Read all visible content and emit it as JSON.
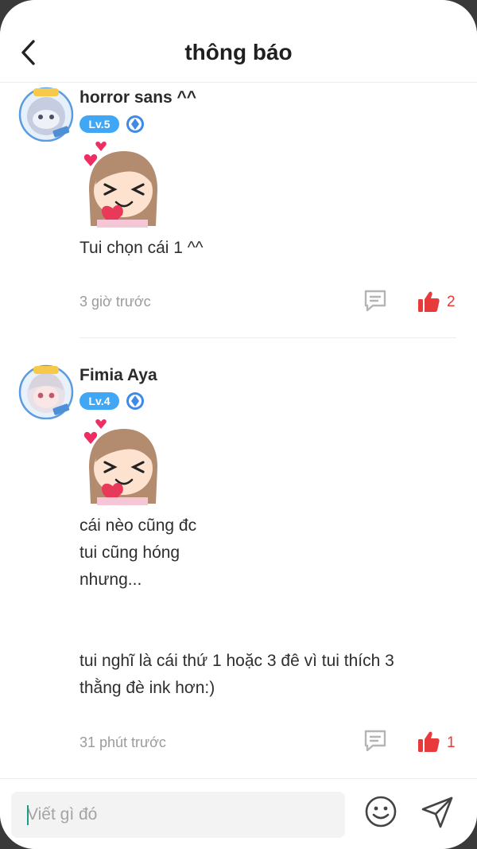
{
  "header": {
    "title": "thông báo",
    "back_icon": "chevron-left-icon"
  },
  "comments": [
    {
      "username": "horror sans ^^",
      "level": "Lv.5",
      "text_lines": [
        "Tui chọn cái 1 ^^"
      ],
      "time": "3 giờ trước",
      "likes": "2"
    },
    {
      "username": "Fimia Aya",
      "level": "Lv.4",
      "text_lines": [
        "cái nèo cũng đc",
        "tui cũng hóng",
        "nhưng...",
        "",
        "",
        "tui nghĩ là cái thứ 1 hoặc 3 đê vì tui thích 3",
        "thằng đè ink hơn:)"
      ],
      "time": "31 phút trước",
      "likes": "1"
    }
  ],
  "composer": {
    "placeholder": "Viết gì đó",
    "emoji_icon": "smile-icon",
    "send_icon": "send-icon"
  },
  "colors": {
    "accent_red": "#e8393b",
    "level_blue": "#3fa7f5",
    "caret": "#1c9a8a"
  }
}
